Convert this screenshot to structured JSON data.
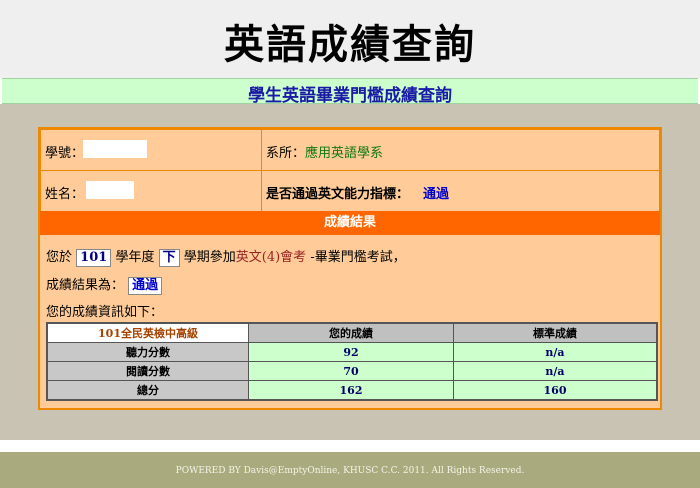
{
  "header": {
    "title": "英語成績查詢",
    "subtitle": "學生英語畢業門檻成績查詢"
  },
  "info": {
    "student_id_label": "學號：",
    "student_id_value": "",
    "department_label": "系所：",
    "department_value": "應用英語學系",
    "name_label": "姓名：",
    "name_value": "",
    "passed_label": "是否通過英文能力指標：",
    "passed_value": "通過"
  },
  "result": {
    "bar_title": "成績結果",
    "sentence_prefix": "您於",
    "year": "101",
    "year_suffix": "學年度",
    "term": "下",
    "sentence_mid": "學期參加",
    "exam_name": "英文(4)會考",
    "sentence_end": "-畢業門檻考試，",
    "result_label": "成績結果為：",
    "result_value": "通過",
    "details_label": "您的成績資訊如下："
  },
  "scores": {
    "headers": [
      "101全民英檢中高級",
      "您的成績",
      "標準成績"
    ],
    "rows": [
      {
        "label": "聽力分數",
        "yours": "92",
        "standard": "n/a"
      },
      {
        "label": "閱讀分數",
        "yours": "70",
        "standard": "n/a"
      },
      {
        "label": "總分",
        "yours": "162",
        "standard": "160"
      }
    ]
  },
  "footer": {
    "text": "POWERED BY Davis@EmptyOnline, KHUSC C.C. 2011. All Rights Reserved."
  },
  "colors": {
    "panel": "#ffcc99",
    "panel_border": "#ee8800",
    "result_bar": "#ff6600",
    "subtitle_bar": "#ccffcc",
    "footer": "#a9aa7e"
  }
}
